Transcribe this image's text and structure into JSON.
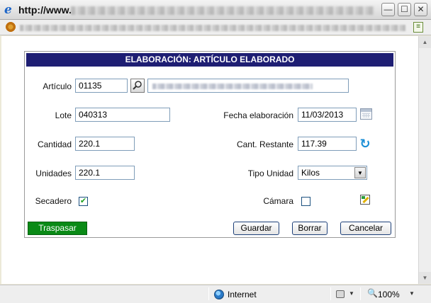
{
  "window": {
    "title_prefix": "http://www.",
    "minimize_glyph": "—",
    "maximize_glyph": "☐",
    "close_glyph": "✕"
  },
  "dialog": {
    "title": "ELABORACIÓN: ARTÍCULO ELABORADO",
    "articulo_label": "Artículo",
    "articulo_value": "01135",
    "lote_label": "Lote",
    "lote_value": "040313",
    "fecha_label": "Fecha elaboración",
    "fecha_value": "11/03/2013",
    "cantidad_label": "Cantidad",
    "cantidad_value": "220.1",
    "cant_restante_label": "Cant. Restante",
    "cant_restante_value": "117.39",
    "unidades_label": "Unidades",
    "unidades_value": "220.1",
    "tipo_unidad_label": "Tipo Unidad",
    "tipo_unidad_value": "Kilos",
    "secadero_label": "Secadero",
    "secadero_checked": true,
    "secadero_glyph": "✔",
    "camara_label": "Cámara",
    "camara_checked": false,
    "traspasar_label": "Traspasar",
    "guardar_label": "Guardar",
    "borrar_label": "Borrar",
    "cancelar_label": "Cancelar"
  },
  "statusbar": {
    "zone": "Internet",
    "zoom": "100%"
  },
  "icons": {
    "search": "magnifier-icon",
    "calendar": "calendar-icon",
    "refresh": "refresh-icon",
    "edit": "edit-icon"
  },
  "colors": {
    "header_bg": "#1e1e73",
    "traspasar_bg": "#0a8a16"
  }
}
